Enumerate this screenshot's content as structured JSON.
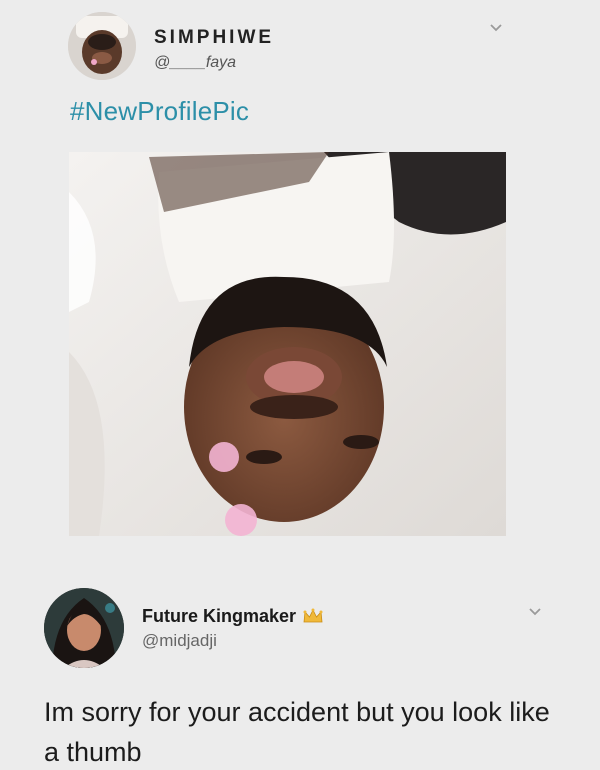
{
  "tweet": {
    "display_name": "SIMPHIWE",
    "handle": "@____faya",
    "hashtag": "#NewProfilePic",
    "avatar_icon": "profile-photo",
    "menu_icon": "chevron-down-icon"
  },
  "reply": {
    "display_name": "Future Kingmaker",
    "handle": "@midjadji",
    "badge_icon": "crown-icon",
    "menu_icon": "chevron-down-icon",
    "text": "Im sorry for your accident but you look like a thumb"
  },
  "colors": {
    "background": "#ececec",
    "hashtag": "#2c8fa8",
    "text": "#1b1b1b",
    "secondary_text": "#666666"
  }
}
